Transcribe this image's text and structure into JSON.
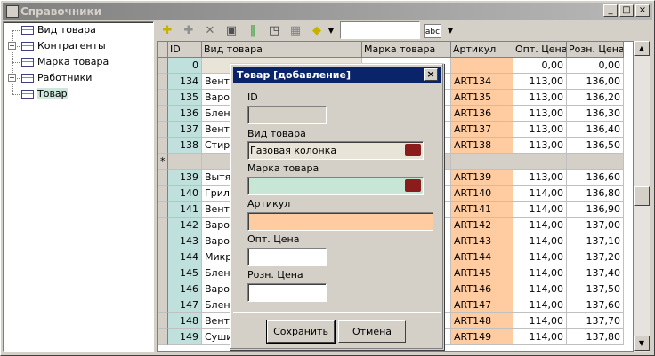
{
  "window": {
    "title": "Справочники",
    "min": "_",
    "max": "□",
    "close": "×"
  },
  "tree": [
    "Вид товара",
    "Контрагенты",
    "Марка товара",
    "Работники",
    "Товар"
  ],
  "tree_expanders": [
    "+",
    "+"
  ],
  "toolbar": {
    "search_value": "",
    "filter_label": "abc"
  },
  "grid": {
    "headers": [
      "ID",
      "Вид товара",
      "Марка товара",
      "Артикул",
      "Опт. Цена",
      "Розн. Цена"
    ],
    "new_row_marker": "*",
    "rows": [
      {
        "ind": "",
        "id": "0",
        "vid": "",
        "art": "",
        "opt": "0,00",
        "rozn": "0,00"
      },
      {
        "ind": "",
        "id": "134",
        "vid": "Венти",
        "art": "ART134",
        "opt": "113,00",
        "rozn": "136,00"
      },
      {
        "ind": "",
        "id": "135",
        "vid": "Вароч",
        "art": "ART135",
        "opt": "113,00",
        "rozn": "136,20"
      },
      {
        "ind": "",
        "id": "136",
        "vid": "Бленд",
        "art": "ART136",
        "opt": "113,00",
        "rozn": "136,30"
      },
      {
        "ind": "",
        "id": "137",
        "vid": "Венти",
        "art": "ART137",
        "opt": "113,00",
        "rozn": "136,40"
      },
      {
        "ind": "",
        "id": "138",
        "vid": "Стира",
        "art": "ART138",
        "opt": "113,00",
        "rozn": "136,50"
      },
      {
        "ind": "*",
        "id": "",
        "vid": "",
        "art": "",
        "opt": "",
        "rozn": ""
      },
      {
        "ind": "",
        "id": "139",
        "vid": "Вытяж",
        "art": "ART139",
        "opt": "113,00",
        "rozn": "136,60"
      },
      {
        "ind": "",
        "id": "140",
        "vid": "Гриль",
        "art": "ART140",
        "opt": "114,00",
        "rozn": "136,80"
      },
      {
        "ind": "",
        "id": "141",
        "vid": "Венти",
        "art": "ART141",
        "opt": "114,00",
        "rozn": "136,90"
      },
      {
        "ind": "",
        "id": "142",
        "vid": "Варо",
        "art": "ART142",
        "opt": "114,00",
        "rozn": "137,00"
      },
      {
        "ind": "",
        "id": "143",
        "vid": "Варо",
        "art": "ART143",
        "opt": "114,00",
        "rozn": "137,10"
      },
      {
        "ind": "",
        "id": "144",
        "vid": "Микр",
        "art": "ART144",
        "opt": "114,00",
        "rozn": "137,20"
      },
      {
        "ind": "",
        "id": "145",
        "vid": "Бленд",
        "art": "ART145",
        "opt": "114,00",
        "rozn": "137,40"
      },
      {
        "ind": "",
        "id": "146",
        "vid": "Варо",
        "art": "ART146",
        "opt": "114,00",
        "rozn": "137,50"
      },
      {
        "ind": "",
        "id": "147",
        "vid": "Бленд",
        "art": "ART147",
        "opt": "114,00",
        "rozn": "137,60"
      },
      {
        "ind": "",
        "id": "148",
        "vid": "Венти",
        "art": "ART148",
        "opt": "114,00",
        "rozn": "137,70"
      },
      {
        "ind": "",
        "id": "149",
        "vid": "Суши.",
        "art": "ART149",
        "opt": "114,00",
        "rozn": "137,80"
      }
    ]
  },
  "dialog": {
    "title": "Товар [добавление]",
    "close": "×",
    "id_label": "ID",
    "id_value": "",
    "vid_label": "Вид товара",
    "vid_value": "Газовая колонка",
    "marka_label": "Марка товара",
    "marka_value": "",
    "art_label": "Артикул",
    "art_value": "",
    "opt_label": "Опт. Цена",
    "opt_value": "",
    "rozn_label": "Розн. Цена",
    "rozn_value": "",
    "save": "Сохранить",
    "cancel": "Отмена"
  },
  "colors": {
    "id_col": "#bfe0dc",
    "art_col": "#ffcba0",
    "marka_field": "#c8e6d6",
    "vid_field": "#e8e4d8",
    "art_field": "#ffcba0",
    "title_active": "#0a246a"
  }
}
